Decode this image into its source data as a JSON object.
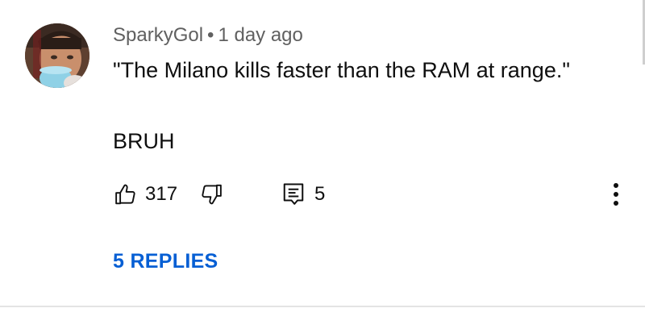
{
  "comment": {
    "author": "SparkyGol",
    "separator": "•",
    "timestamp": "1 day ago",
    "text_line1": "\"The Milano kills faster than the RAM at range.\"",
    "text_line2": "BRUH"
  },
  "actions": {
    "like_icon": "thumbs-up-icon",
    "like_count": "317",
    "dislike_icon": "thumbs-down-icon",
    "reply_icon": "reply-icon",
    "reply_count": "5",
    "more_icon": "more-vertical-icon"
  },
  "replies_label": "5 REPLIES",
  "colors": {
    "meta_text": "#606060",
    "body_text": "#0f0f0f",
    "link_blue": "#065fd4",
    "divider": "#e4e4e4"
  }
}
